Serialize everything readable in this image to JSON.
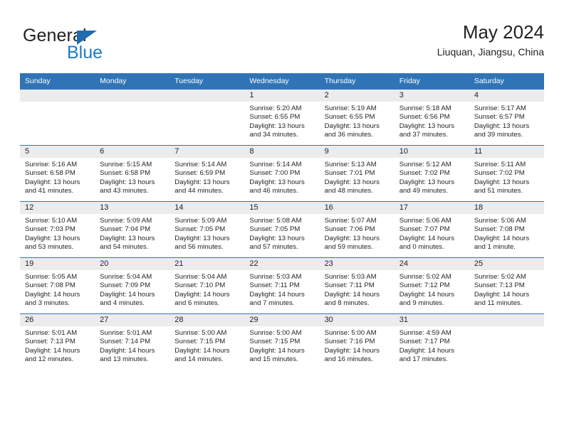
{
  "logo": {
    "word_one": "General",
    "word_two": "Blue",
    "triangle_icon": "triangle-icon",
    "brand_color": "#1f7bc4"
  },
  "header": {
    "title": "May 2024",
    "subtitle": "Liuquan, Jiangsu, China",
    "header_bg_color": "#3174b5",
    "daynum_bg_color": "#ececec"
  },
  "weekdays": [
    "Sunday",
    "Monday",
    "Tuesday",
    "Wednesday",
    "Thursday",
    "Friday",
    "Saturday"
  ],
  "weeks": [
    [
      {
        "day": "",
        "sunrise": "",
        "sunset": "",
        "daylight_line1": "",
        "daylight_line2": ""
      },
      {
        "day": "",
        "sunrise": "",
        "sunset": "",
        "daylight_line1": "",
        "daylight_line2": ""
      },
      {
        "day": "",
        "sunrise": "",
        "sunset": "",
        "daylight_line1": "",
        "daylight_line2": ""
      },
      {
        "day": "1",
        "sunrise": "Sunrise: 5:20 AM",
        "sunset": "Sunset: 6:55 PM",
        "daylight_line1": "Daylight: 13 hours",
        "daylight_line2": "and 34 minutes."
      },
      {
        "day": "2",
        "sunrise": "Sunrise: 5:19 AM",
        "sunset": "Sunset: 6:55 PM",
        "daylight_line1": "Daylight: 13 hours",
        "daylight_line2": "and 36 minutes."
      },
      {
        "day": "3",
        "sunrise": "Sunrise: 5:18 AM",
        "sunset": "Sunset: 6:56 PM",
        "daylight_line1": "Daylight: 13 hours",
        "daylight_line2": "and 37 minutes."
      },
      {
        "day": "4",
        "sunrise": "Sunrise: 5:17 AM",
        "sunset": "Sunset: 6:57 PM",
        "daylight_line1": "Daylight: 13 hours",
        "daylight_line2": "and 39 minutes."
      }
    ],
    [
      {
        "day": "5",
        "sunrise": "Sunrise: 5:16 AM",
        "sunset": "Sunset: 6:58 PM",
        "daylight_line1": "Daylight: 13 hours",
        "daylight_line2": "and 41 minutes."
      },
      {
        "day": "6",
        "sunrise": "Sunrise: 5:15 AM",
        "sunset": "Sunset: 6:58 PM",
        "daylight_line1": "Daylight: 13 hours",
        "daylight_line2": "and 43 minutes."
      },
      {
        "day": "7",
        "sunrise": "Sunrise: 5:14 AM",
        "sunset": "Sunset: 6:59 PM",
        "daylight_line1": "Daylight: 13 hours",
        "daylight_line2": "and 44 minutes."
      },
      {
        "day": "8",
        "sunrise": "Sunrise: 5:14 AM",
        "sunset": "Sunset: 7:00 PM",
        "daylight_line1": "Daylight: 13 hours",
        "daylight_line2": "and 46 minutes."
      },
      {
        "day": "9",
        "sunrise": "Sunrise: 5:13 AM",
        "sunset": "Sunset: 7:01 PM",
        "daylight_line1": "Daylight: 13 hours",
        "daylight_line2": "and 48 minutes."
      },
      {
        "day": "10",
        "sunrise": "Sunrise: 5:12 AM",
        "sunset": "Sunset: 7:02 PM",
        "daylight_line1": "Daylight: 13 hours",
        "daylight_line2": "and 49 minutes."
      },
      {
        "day": "11",
        "sunrise": "Sunrise: 5:11 AM",
        "sunset": "Sunset: 7:02 PM",
        "daylight_line1": "Daylight: 13 hours",
        "daylight_line2": "and 51 minutes."
      }
    ],
    [
      {
        "day": "12",
        "sunrise": "Sunrise: 5:10 AM",
        "sunset": "Sunset: 7:03 PM",
        "daylight_line1": "Daylight: 13 hours",
        "daylight_line2": "and 53 minutes."
      },
      {
        "day": "13",
        "sunrise": "Sunrise: 5:09 AM",
        "sunset": "Sunset: 7:04 PM",
        "daylight_line1": "Daylight: 13 hours",
        "daylight_line2": "and 54 minutes."
      },
      {
        "day": "14",
        "sunrise": "Sunrise: 5:09 AM",
        "sunset": "Sunset: 7:05 PM",
        "daylight_line1": "Daylight: 13 hours",
        "daylight_line2": "and 56 minutes."
      },
      {
        "day": "15",
        "sunrise": "Sunrise: 5:08 AM",
        "sunset": "Sunset: 7:05 PM",
        "daylight_line1": "Daylight: 13 hours",
        "daylight_line2": "and 57 minutes."
      },
      {
        "day": "16",
        "sunrise": "Sunrise: 5:07 AM",
        "sunset": "Sunset: 7:06 PM",
        "daylight_line1": "Daylight: 13 hours",
        "daylight_line2": "and 59 minutes."
      },
      {
        "day": "17",
        "sunrise": "Sunrise: 5:06 AM",
        "sunset": "Sunset: 7:07 PM",
        "daylight_line1": "Daylight: 14 hours",
        "daylight_line2": "and 0 minutes."
      },
      {
        "day": "18",
        "sunrise": "Sunrise: 5:06 AM",
        "sunset": "Sunset: 7:08 PM",
        "daylight_line1": "Daylight: 14 hours",
        "daylight_line2": "and 1 minute."
      }
    ],
    [
      {
        "day": "19",
        "sunrise": "Sunrise: 5:05 AM",
        "sunset": "Sunset: 7:08 PM",
        "daylight_line1": "Daylight: 14 hours",
        "daylight_line2": "and 3 minutes."
      },
      {
        "day": "20",
        "sunrise": "Sunrise: 5:04 AM",
        "sunset": "Sunset: 7:09 PM",
        "daylight_line1": "Daylight: 14 hours",
        "daylight_line2": "and 4 minutes."
      },
      {
        "day": "21",
        "sunrise": "Sunrise: 5:04 AM",
        "sunset": "Sunset: 7:10 PM",
        "daylight_line1": "Daylight: 14 hours",
        "daylight_line2": "and 6 minutes."
      },
      {
        "day": "22",
        "sunrise": "Sunrise: 5:03 AM",
        "sunset": "Sunset: 7:11 PM",
        "daylight_line1": "Daylight: 14 hours",
        "daylight_line2": "and 7 minutes."
      },
      {
        "day": "23",
        "sunrise": "Sunrise: 5:03 AM",
        "sunset": "Sunset: 7:11 PM",
        "daylight_line1": "Daylight: 14 hours",
        "daylight_line2": "and 8 minutes."
      },
      {
        "day": "24",
        "sunrise": "Sunrise: 5:02 AM",
        "sunset": "Sunset: 7:12 PM",
        "daylight_line1": "Daylight: 14 hours",
        "daylight_line2": "and 9 minutes."
      },
      {
        "day": "25",
        "sunrise": "Sunrise: 5:02 AM",
        "sunset": "Sunset: 7:13 PM",
        "daylight_line1": "Daylight: 14 hours",
        "daylight_line2": "and 11 minutes."
      }
    ],
    [
      {
        "day": "26",
        "sunrise": "Sunrise: 5:01 AM",
        "sunset": "Sunset: 7:13 PM",
        "daylight_line1": "Daylight: 14 hours",
        "daylight_line2": "and 12 minutes."
      },
      {
        "day": "27",
        "sunrise": "Sunrise: 5:01 AM",
        "sunset": "Sunset: 7:14 PM",
        "daylight_line1": "Daylight: 14 hours",
        "daylight_line2": "and 13 minutes."
      },
      {
        "day": "28",
        "sunrise": "Sunrise: 5:00 AM",
        "sunset": "Sunset: 7:15 PM",
        "daylight_line1": "Daylight: 14 hours",
        "daylight_line2": "and 14 minutes."
      },
      {
        "day": "29",
        "sunrise": "Sunrise: 5:00 AM",
        "sunset": "Sunset: 7:15 PM",
        "daylight_line1": "Daylight: 14 hours",
        "daylight_line2": "and 15 minutes."
      },
      {
        "day": "30",
        "sunrise": "Sunrise: 5:00 AM",
        "sunset": "Sunset: 7:16 PM",
        "daylight_line1": "Daylight: 14 hours",
        "daylight_line2": "and 16 minutes."
      },
      {
        "day": "31",
        "sunrise": "Sunrise: 4:59 AM",
        "sunset": "Sunset: 7:17 PM",
        "daylight_line1": "Daylight: 14 hours",
        "daylight_line2": "and 17 minutes."
      },
      {
        "day": "",
        "sunrise": "",
        "sunset": "",
        "daylight_line1": "",
        "daylight_line2": ""
      }
    ]
  ]
}
